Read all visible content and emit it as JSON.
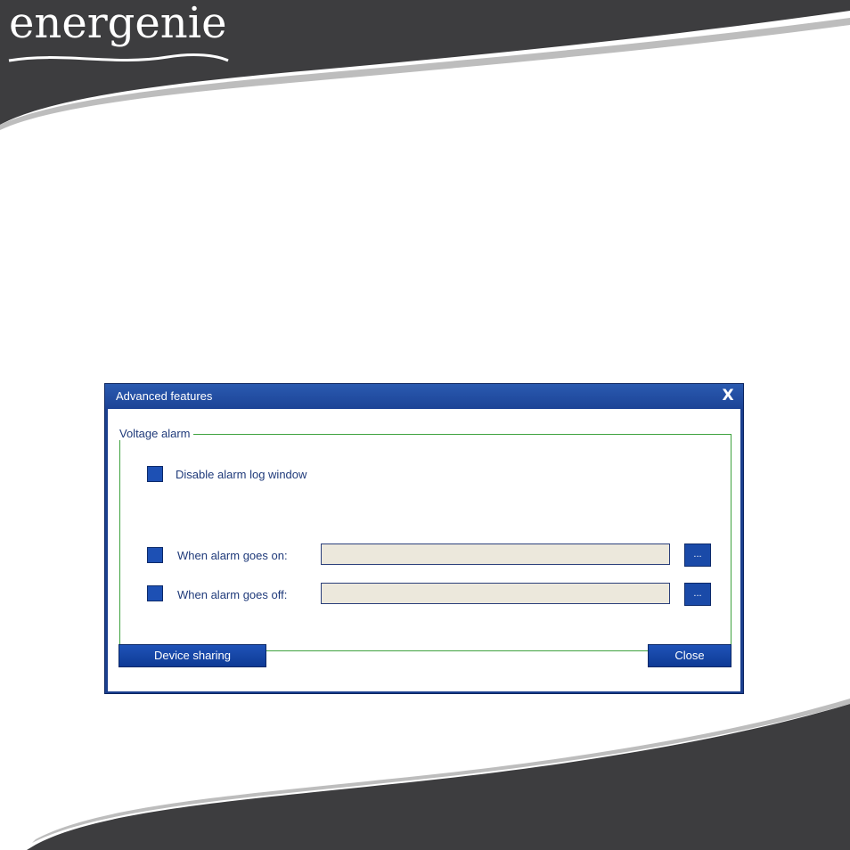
{
  "brand": {
    "logo_text": "energenie"
  },
  "dialog": {
    "title": "Advanced features",
    "close_glyph": "X",
    "group": {
      "legend": "Voltage alarm",
      "disable_log_label": "Disable alarm log window",
      "alarm_on_label": "When alarm goes on:",
      "alarm_off_label": "When alarm goes off:",
      "alarm_on_value": "",
      "alarm_off_value": "",
      "browse_label": "..."
    },
    "buttons": {
      "device_sharing": "Device sharing",
      "close": "Close"
    }
  },
  "colors": {
    "accent": "#1b3f8f",
    "checkbox": "#1d50b4",
    "group_border": "#3fa23f",
    "field_bg": "#ece8dc",
    "swoosh": "#3d3d3f"
  },
  "icons": {
    "close": "close-icon"
  }
}
